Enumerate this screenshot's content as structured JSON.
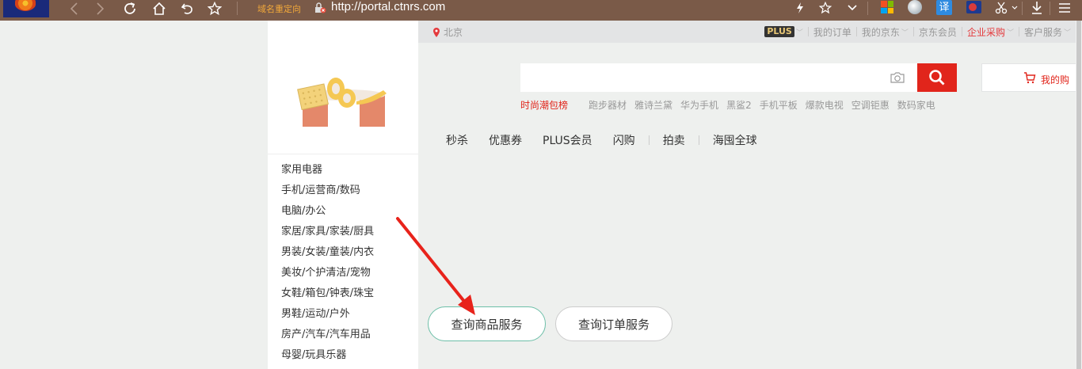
{
  "browser": {
    "redirect_label": "域名重定向",
    "url": "http://portal.ctnrs.com",
    "translate_label": "译"
  },
  "topbar": {
    "location": "北京",
    "plus": "PLUS",
    "items": [
      "我的订单",
      "我的京东",
      "京东会员",
      "企业采购",
      "客户服务"
    ]
  },
  "categories": [
    "家用电器",
    "手机/运营商/数码",
    "电脑/办公",
    "家居/家具/家装/厨具",
    "男装/女装/童装/内衣",
    "美妆/个护清洁/宠物",
    "女鞋/箱包/钟表/珠宝",
    "男鞋/运动/户外",
    "房产/汽车/汽车用品",
    "母婴/玩具乐器"
  ],
  "search": {
    "placeholder": "",
    "hotwords": [
      "时尚潮包榜",
      "跑步器材",
      "雅诗兰黛",
      "华为手机",
      "黑鲨2",
      "手机平板",
      "爆款电视",
      "空调钜惠",
      "数码家电"
    ]
  },
  "cart": {
    "label": "我的购"
  },
  "mainnav": [
    "秒杀",
    "优惠券",
    "PLUS会员",
    "闪购",
    "拍卖",
    "海囤全球"
  ],
  "buttons": {
    "product_service": "查询商品服务",
    "order_service": "查询订单服务"
  },
  "colors": {
    "jd_red": "#e1251b",
    "browser_bar": "#7a5a48",
    "annotation_arrow": "#e8231b"
  }
}
